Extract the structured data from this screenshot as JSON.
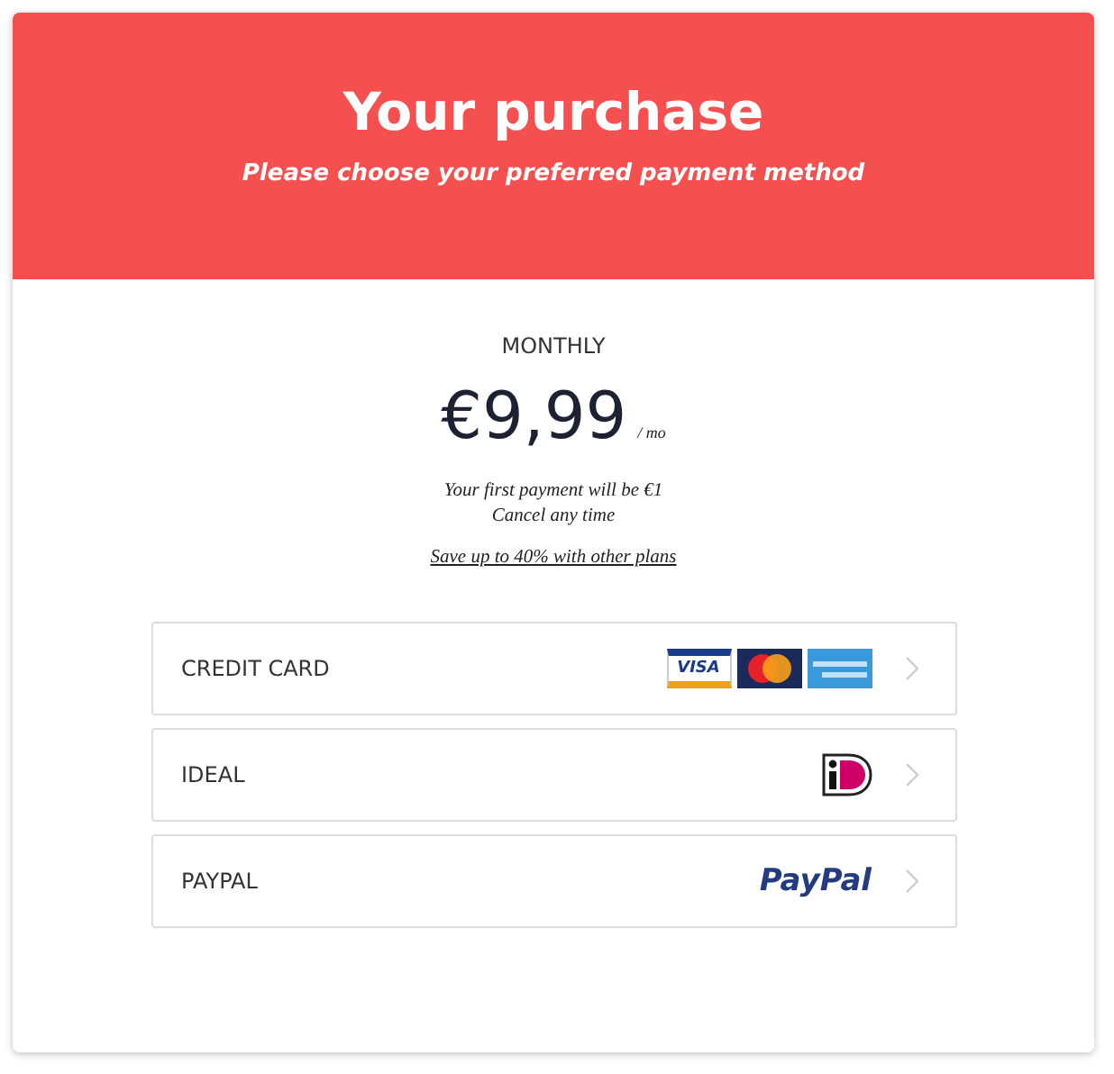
{
  "header": {
    "title": "Your purchase",
    "subtitle": "Please choose your preferred payment method"
  },
  "plan": {
    "name": "MONTHLY",
    "price": "€9,99",
    "period": "/ mo",
    "notes": [
      "Your first payment will be €1",
      "Cancel any time"
    ],
    "link": "Save up to 40% with other plans"
  },
  "methods": [
    {
      "label": "CREDIT CARD",
      "kind": "cards",
      "logo_text": "VISA"
    },
    {
      "label": "IDEAL",
      "kind": "ideal"
    },
    {
      "label": "PAYPAL",
      "kind": "paypal",
      "logo_text": "PayPal"
    }
  ]
}
